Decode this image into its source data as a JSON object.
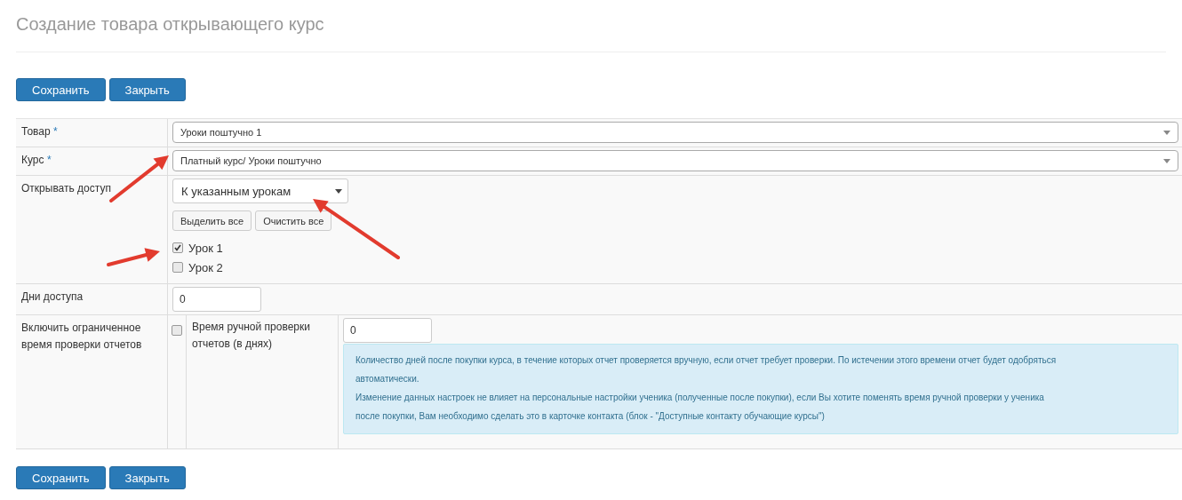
{
  "title": "Создание товара открывающего курс",
  "top_buttons": [
    "Сохранить",
    "Закрыть"
  ],
  "product": {
    "label": "Товар",
    "required_mark": "*",
    "value": "Уроки поштучно 1"
  },
  "course": {
    "label": "Курс",
    "required_mark": "*",
    "value": "Платный курс/ Уроки поштучно"
  },
  "access": {
    "label": "Открывать доступ",
    "mode": "К указанным урокам",
    "select_buttons": [
      "Выделить все",
      "Очистить все"
    ],
    "lessons": [
      {
        "label": "Урок 1",
        "checked": true
      },
      {
        "label": "Урок 2",
        "checked": false
      }
    ]
  },
  "access_days": {
    "label": "Дни доступа",
    "value": "0"
  },
  "review": {
    "label": "Включить ограниченное время проверки отчетов",
    "checked": false,
    "days_label": "Время ручной проверки отчетов (в днях)",
    "days_value": "0",
    "hint": [
      "Количество дней после покупки курса, в течение которых отчет проверяется вручную, если отчет требует проверки. По истечении этого времени отчет будет одобряться автоматически.",
      "Изменение данных настроек не влияет на персональные настройки ученика (полученные после покупки), если Вы хотите поменять время ручной проверки у ученика после покупки, Вам необходимо сделать это в карточке контакта (блок - \"Доступные контакту обучающие курсы\")"
    ]
  },
  "bottom_buttons": [
    "Сохранить",
    "Закрыть"
  ]
}
